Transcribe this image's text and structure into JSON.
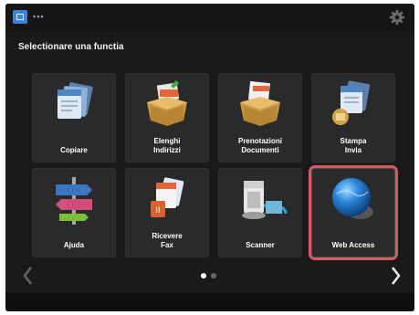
{
  "header": {
    "title": "▪▪▪"
  },
  "prompt": "Selectionare una functia",
  "tiles": [
    {
      "label": "Copiare",
      "icon": "copy-icon"
    },
    {
      "label": "Elenghi / Indirizzi",
      "icon": "address-box-icon"
    },
    {
      "label": "Prenotazioni / Documenti",
      "icon": "document-box-icon"
    },
    {
      "label": "Stampa / Invia",
      "icon": "scan-send-icon"
    },
    {
      "label": "Ajuda",
      "icon": "signpost-help-icon"
    },
    {
      "label": "Ricevere / Fax",
      "icon": "fax-receive-icon"
    },
    {
      "label": "Scanner",
      "icon": "scanner-icon"
    },
    {
      "label": "Web Access",
      "icon": "globe-icon"
    }
  ],
  "selected_tile_index": 7,
  "pagination": {
    "pages": 2,
    "current": 1
  },
  "colors": {
    "selection": "#d25b66",
    "accent": "#3b82d8"
  }
}
